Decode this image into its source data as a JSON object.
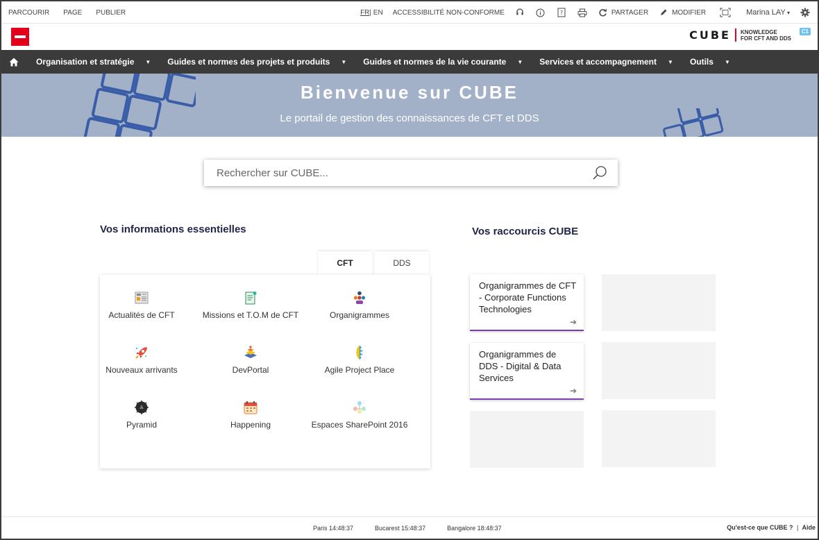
{
  "ribbon": {
    "left_items": [
      "PARCOURIR",
      "PAGE",
      "PUBLIER"
    ],
    "lang_active": "FR",
    "lang_separator": "|",
    "lang_other": "EN",
    "accessibility": "ACCESSIBILITÉ NON-CONFORME",
    "share_label": "PARTAGER",
    "edit_label": "MODIFIER",
    "user_name": "Marina LAY"
  },
  "brand": {
    "cube_word": "CUBE",
    "cube_sub_line1": "KNOWLEDGE",
    "cube_sub_line2": "FOR CFT AND DDS",
    "badge": "C1"
  },
  "nav": {
    "items": [
      {
        "label": "Organisation et stratégie"
      },
      {
        "label": "Guides et normes des projets et produits"
      },
      {
        "label": "Guides et normes de la vie courante"
      },
      {
        "label": "Services et accompagnement"
      },
      {
        "label": "Outils"
      }
    ]
  },
  "banner": {
    "title": "Bienvenue sur CUBE",
    "subtitle": "Le portail de gestion des connaissances de CFT et DDS"
  },
  "search": {
    "placeholder": "Rechercher sur CUBE..."
  },
  "essentials": {
    "heading": "Vos informations essentielles",
    "tabs": [
      "CFT",
      "DDS"
    ],
    "apps": [
      {
        "label": "Actualités de CFT",
        "icon": "news-icon"
      },
      {
        "label": "Missions et T.O.M de CFT",
        "icon": "clipboard-icon"
      },
      {
        "label": "Organigrammes",
        "icon": "org-chart-icon"
      },
      {
        "label": "Nouveaux arrivants",
        "icon": "rocket-icon"
      },
      {
        "label": "DevPortal",
        "icon": "devportal-icon"
      },
      {
        "label": "Agile Project Place",
        "icon": "agile-icon"
      },
      {
        "label": "Pyramid",
        "icon": "pyramid-icon"
      },
      {
        "label": "Happening",
        "icon": "calendar-icon"
      },
      {
        "label": "Espaces SharePoint 2016",
        "icon": "sharepoint-icon"
      }
    ]
  },
  "shortcuts": {
    "heading": "Vos raccourcis CUBE",
    "items": [
      {
        "label": "Organigrammes de CFT - Corporate Functions Technologies"
      },
      {
        "label": "Organigrammes de DDS - Digital & Data Services"
      }
    ],
    "arrow": "➔"
  },
  "footer": {
    "clocks": [
      "Paris 14:48:37",
      "Bucarest 15:48:37",
      "Bangalore 18:48:37"
    ],
    "link_whatis": "Qu'est-ce que CUBE ?",
    "link_separator": "|",
    "link_help": "Aide"
  },
  "colors": {
    "brand_red": "#e2001a",
    "nav_bg": "#3b3b3b",
    "banner_bg": "#a2b0c8",
    "shortcut_accent": "#7d3cb0",
    "heading_navy": "#1f2447"
  }
}
